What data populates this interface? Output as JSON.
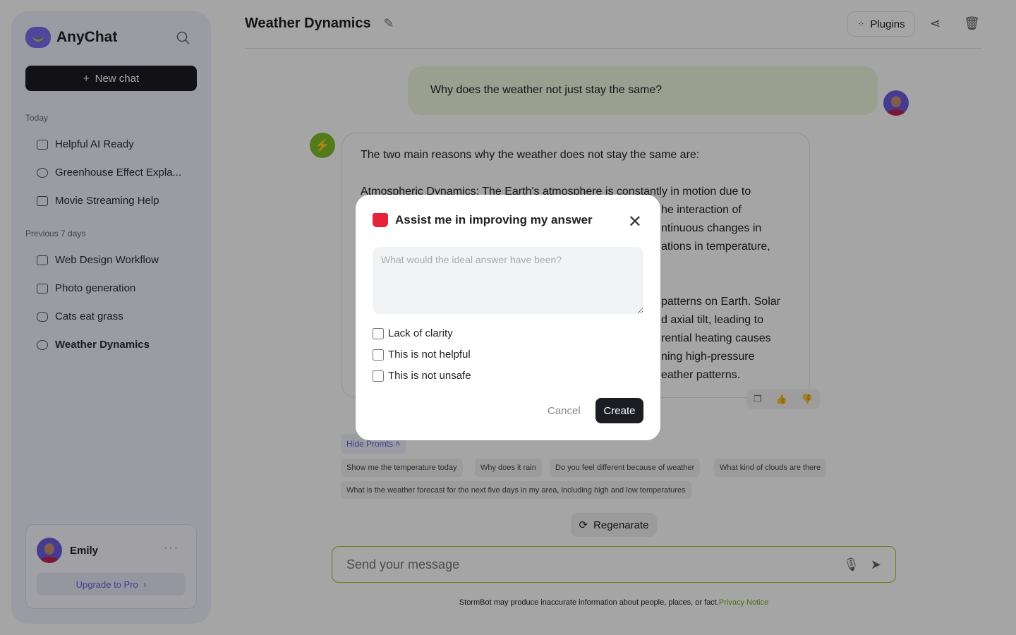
{
  "sidebar": {
    "brand": "AnyChat",
    "new_chat": "New chat",
    "today_label": "Today",
    "today": [
      {
        "label": "Helpful AI Ready"
      },
      {
        "label": "Greenhouse Effect Expla..."
      },
      {
        "label": "Movie Streaming Help"
      }
    ],
    "prev_label": "Previous 7 days",
    "prev": [
      {
        "label": "Web Design Workflow"
      },
      {
        "label": "Photo generation"
      },
      {
        "label": "Cats eat grass"
      },
      {
        "label": "Weather Dynamics",
        "active": true
      }
    ],
    "user": {
      "name": "Emily",
      "upgrade": "Upgrade to Pro"
    }
  },
  "header": {
    "title": "Weather Dynamics",
    "plugins": "Plugins"
  },
  "chat": {
    "user_message": "Why does the weather not just stay the same?",
    "answer_lines": [
      "The two main reasons why the weather does not stay the same are:",
      "Atmospheric Dynamics: The Earth's atmosphere is constantly in motion due to",
      "he interaction of",
      "ntinuous changes in",
      "ations in temperature,",
      "patterns on Earth. Solar",
      "d axial tilt, leading to",
      "rential heating causes",
      "ning high-pressure",
      "eather patterns."
    ]
  },
  "prompts": {
    "hide": "Hide Promts",
    "items": [
      "Show me the temperature today",
      "Why does it rain",
      "Do you feel different because of weather",
      "What kind of clouds are there",
      "What is the weather forecast for the next five days in my area, including high and low temperatures"
    ]
  },
  "regenerate": "Regenarate",
  "composer": {
    "placeholder": "Send your message"
  },
  "footer": {
    "text": "StormBot may produce inaccurate information about people, places, or fact.",
    "link": "Privacy Notice"
  },
  "modal": {
    "title": "Assist me in improving my answer",
    "placeholder": "What would the ideal answer have been?",
    "options": [
      "Lack of clarity",
      "This is not helpful",
      "This is not unsafe"
    ],
    "cancel": "Cancel",
    "create": "Create"
  },
  "colors": {
    "accent": "#6b5ce0",
    "brand_green": "#9ec62d",
    "danger": "#e5243b"
  }
}
